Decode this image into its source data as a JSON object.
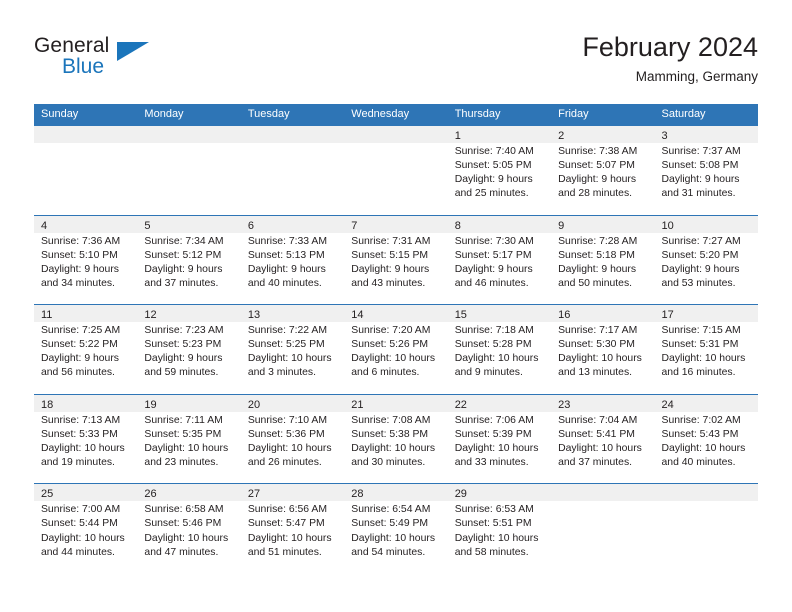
{
  "brand": {
    "word1": "General",
    "word2": "Blue",
    "triangle_color": "#1b75bb",
    "blue_text_color": "#1b75bb"
  },
  "header": {
    "title": "February 2024",
    "subtitle": "Mamming, Germany"
  },
  "theme": {
    "header_row_bg": "#2e75b6",
    "header_row_text": "#ffffff",
    "day_band_bg": "#f0f0f0",
    "cell_border": "#2e75b6",
    "body_text": "#231f20"
  },
  "weekdays": [
    "Sunday",
    "Monday",
    "Tuesday",
    "Wednesday",
    "Thursday",
    "Friday",
    "Saturday"
  ],
  "weeks": [
    [
      {
        "day": "",
        "empty": true,
        "sunrise": "",
        "sunset": "",
        "daylight_line1": "",
        "daylight_line2": ""
      },
      {
        "day": "",
        "empty": true,
        "sunrise": "",
        "sunset": "",
        "daylight_line1": "",
        "daylight_line2": ""
      },
      {
        "day": "",
        "empty": true,
        "sunrise": "",
        "sunset": "",
        "daylight_line1": "",
        "daylight_line2": ""
      },
      {
        "day": "",
        "empty": true,
        "sunrise": "",
        "sunset": "",
        "daylight_line1": "",
        "daylight_line2": ""
      },
      {
        "day": "1",
        "empty": false,
        "sunrise": "Sunrise: 7:40 AM",
        "sunset": "Sunset: 5:05 PM",
        "daylight_line1": "Daylight: 9 hours",
        "daylight_line2": "and 25 minutes."
      },
      {
        "day": "2",
        "empty": false,
        "sunrise": "Sunrise: 7:38 AM",
        "sunset": "Sunset: 5:07 PM",
        "daylight_line1": "Daylight: 9 hours",
        "daylight_line2": "and 28 minutes."
      },
      {
        "day": "3",
        "empty": false,
        "sunrise": "Sunrise: 7:37 AM",
        "sunset": "Sunset: 5:08 PM",
        "daylight_line1": "Daylight: 9 hours",
        "daylight_line2": "and 31 minutes."
      }
    ],
    [
      {
        "day": "4",
        "empty": false,
        "sunrise": "Sunrise: 7:36 AM",
        "sunset": "Sunset: 5:10 PM",
        "daylight_line1": "Daylight: 9 hours",
        "daylight_line2": "and 34 minutes."
      },
      {
        "day": "5",
        "empty": false,
        "sunrise": "Sunrise: 7:34 AM",
        "sunset": "Sunset: 5:12 PM",
        "daylight_line1": "Daylight: 9 hours",
        "daylight_line2": "and 37 minutes."
      },
      {
        "day": "6",
        "empty": false,
        "sunrise": "Sunrise: 7:33 AM",
        "sunset": "Sunset: 5:13 PM",
        "daylight_line1": "Daylight: 9 hours",
        "daylight_line2": "and 40 minutes."
      },
      {
        "day": "7",
        "empty": false,
        "sunrise": "Sunrise: 7:31 AM",
        "sunset": "Sunset: 5:15 PM",
        "daylight_line1": "Daylight: 9 hours",
        "daylight_line2": "and 43 minutes."
      },
      {
        "day": "8",
        "empty": false,
        "sunrise": "Sunrise: 7:30 AM",
        "sunset": "Sunset: 5:17 PM",
        "daylight_line1": "Daylight: 9 hours",
        "daylight_line2": "and 46 minutes."
      },
      {
        "day": "9",
        "empty": false,
        "sunrise": "Sunrise: 7:28 AM",
        "sunset": "Sunset: 5:18 PM",
        "daylight_line1": "Daylight: 9 hours",
        "daylight_line2": "and 50 minutes."
      },
      {
        "day": "10",
        "empty": false,
        "sunrise": "Sunrise: 7:27 AM",
        "sunset": "Sunset: 5:20 PM",
        "daylight_line1": "Daylight: 9 hours",
        "daylight_line2": "and 53 minutes."
      }
    ],
    [
      {
        "day": "11",
        "empty": false,
        "sunrise": "Sunrise: 7:25 AM",
        "sunset": "Sunset: 5:22 PM",
        "daylight_line1": "Daylight: 9 hours",
        "daylight_line2": "and 56 minutes."
      },
      {
        "day": "12",
        "empty": false,
        "sunrise": "Sunrise: 7:23 AM",
        "sunset": "Sunset: 5:23 PM",
        "daylight_line1": "Daylight: 9 hours",
        "daylight_line2": "and 59 minutes."
      },
      {
        "day": "13",
        "empty": false,
        "sunrise": "Sunrise: 7:22 AM",
        "sunset": "Sunset: 5:25 PM",
        "daylight_line1": "Daylight: 10 hours",
        "daylight_line2": "and 3 minutes."
      },
      {
        "day": "14",
        "empty": false,
        "sunrise": "Sunrise: 7:20 AM",
        "sunset": "Sunset: 5:26 PM",
        "daylight_line1": "Daylight: 10 hours",
        "daylight_line2": "and 6 minutes."
      },
      {
        "day": "15",
        "empty": false,
        "sunrise": "Sunrise: 7:18 AM",
        "sunset": "Sunset: 5:28 PM",
        "daylight_line1": "Daylight: 10 hours",
        "daylight_line2": "and 9 minutes."
      },
      {
        "day": "16",
        "empty": false,
        "sunrise": "Sunrise: 7:17 AM",
        "sunset": "Sunset: 5:30 PM",
        "daylight_line1": "Daylight: 10 hours",
        "daylight_line2": "and 13 minutes."
      },
      {
        "day": "17",
        "empty": false,
        "sunrise": "Sunrise: 7:15 AM",
        "sunset": "Sunset: 5:31 PM",
        "daylight_line1": "Daylight: 10 hours",
        "daylight_line2": "and 16 minutes."
      }
    ],
    [
      {
        "day": "18",
        "empty": false,
        "sunrise": "Sunrise: 7:13 AM",
        "sunset": "Sunset: 5:33 PM",
        "daylight_line1": "Daylight: 10 hours",
        "daylight_line2": "and 19 minutes."
      },
      {
        "day": "19",
        "empty": false,
        "sunrise": "Sunrise: 7:11 AM",
        "sunset": "Sunset: 5:35 PM",
        "daylight_line1": "Daylight: 10 hours",
        "daylight_line2": "and 23 minutes."
      },
      {
        "day": "20",
        "empty": false,
        "sunrise": "Sunrise: 7:10 AM",
        "sunset": "Sunset: 5:36 PM",
        "daylight_line1": "Daylight: 10 hours",
        "daylight_line2": "and 26 minutes."
      },
      {
        "day": "21",
        "empty": false,
        "sunrise": "Sunrise: 7:08 AM",
        "sunset": "Sunset: 5:38 PM",
        "daylight_line1": "Daylight: 10 hours",
        "daylight_line2": "and 30 minutes."
      },
      {
        "day": "22",
        "empty": false,
        "sunrise": "Sunrise: 7:06 AM",
        "sunset": "Sunset: 5:39 PM",
        "daylight_line1": "Daylight: 10 hours",
        "daylight_line2": "and 33 minutes."
      },
      {
        "day": "23",
        "empty": false,
        "sunrise": "Sunrise: 7:04 AM",
        "sunset": "Sunset: 5:41 PM",
        "daylight_line1": "Daylight: 10 hours",
        "daylight_line2": "and 37 minutes."
      },
      {
        "day": "24",
        "empty": false,
        "sunrise": "Sunrise: 7:02 AM",
        "sunset": "Sunset: 5:43 PM",
        "daylight_line1": "Daylight: 10 hours",
        "daylight_line2": "and 40 minutes."
      }
    ],
    [
      {
        "day": "25",
        "empty": false,
        "sunrise": "Sunrise: 7:00 AM",
        "sunset": "Sunset: 5:44 PM",
        "daylight_line1": "Daylight: 10 hours",
        "daylight_line2": "and 44 minutes."
      },
      {
        "day": "26",
        "empty": false,
        "sunrise": "Sunrise: 6:58 AM",
        "sunset": "Sunset: 5:46 PM",
        "daylight_line1": "Daylight: 10 hours",
        "daylight_line2": "and 47 minutes."
      },
      {
        "day": "27",
        "empty": false,
        "sunrise": "Sunrise: 6:56 AM",
        "sunset": "Sunset: 5:47 PM",
        "daylight_line1": "Daylight: 10 hours",
        "daylight_line2": "and 51 minutes."
      },
      {
        "day": "28",
        "empty": false,
        "sunrise": "Sunrise: 6:54 AM",
        "sunset": "Sunset: 5:49 PM",
        "daylight_line1": "Daylight: 10 hours",
        "daylight_line2": "and 54 minutes."
      },
      {
        "day": "29",
        "empty": false,
        "sunrise": "Sunrise: 6:53 AM",
        "sunset": "Sunset: 5:51 PM",
        "daylight_line1": "Daylight: 10 hours",
        "daylight_line2": "and 58 minutes."
      },
      {
        "day": "",
        "empty": true,
        "sunrise": "",
        "sunset": "",
        "daylight_line1": "",
        "daylight_line2": ""
      },
      {
        "day": "",
        "empty": true,
        "sunrise": "",
        "sunset": "",
        "daylight_line1": "",
        "daylight_line2": ""
      }
    ]
  ]
}
